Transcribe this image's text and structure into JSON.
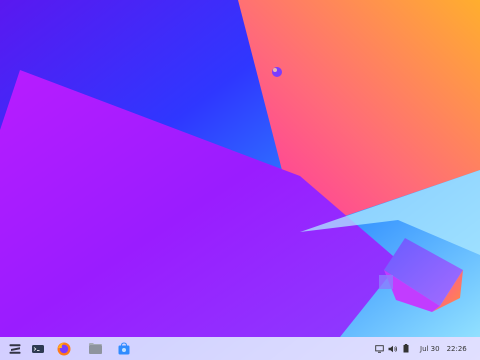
{
  "taskbar": {
    "apps": [
      {
        "name": "zorin-menu-icon"
      },
      {
        "name": "terminal-icon"
      },
      {
        "name": "firefox-icon"
      },
      {
        "name": "files-icon"
      },
      {
        "name": "software-store-icon"
      }
    ],
    "tray": [
      {
        "name": "display-icon"
      },
      {
        "name": "volume-icon"
      },
      {
        "name": "battery-icon"
      }
    ],
    "clock": {
      "date": "Jul 30",
      "time": "22:26"
    }
  },
  "colors": {
    "taskbar_bg": "#ebdeff",
    "accent_purple": "#b01cff",
    "accent_orange": "#ff9c3a"
  }
}
